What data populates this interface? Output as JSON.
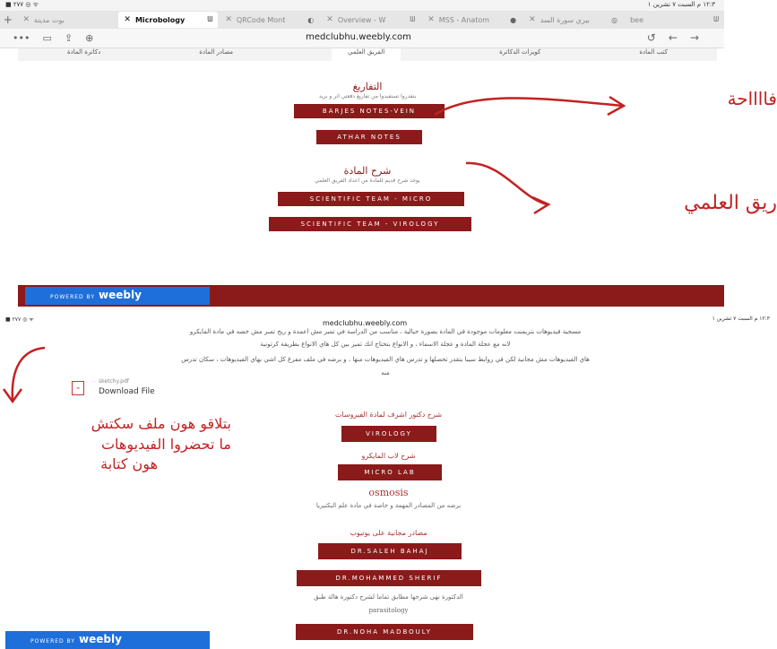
{
  "shot1": {
    "status_left": "■ ٢٧٧ ◎ ᯤ",
    "status_right": "١٢:٣ م  السبت ٧ تشرين ١",
    "tabs": [
      {
        "label": "بوت مدينة"
      },
      {
        "label": "Microbology"
      },
      {
        "label": "QRCode Mont"
      },
      {
        "label": "Overview - W"
      },
      {
        "label": "MSS - Anatom"
      },
      {
        "label": "بيري سورة السد"
      },
      {
        "label": "bee"
      }
    ],
    "url": "medclubhu.weebly.com",
    "site_nav": [
      "كتب المادة",
      "كويزات الدكاترة",
      "الفريق العلمي",
      "مصادر المادة",
      "دكاترة المادة"
    ],
    "sections": [
      {
        "title": "التفاريغ",
        "subtitle": "بتقدروا تستفيدوا من تفاريغ دفعتي اثر و بريد",
        "buttons": [
          "BARJES NOTES-VEIN",
          "ATHAR NOTES"
        ]
      },
      {
        "title": "شرح المادة",
        "subtitle": "يوجد شرح قديم للمادة من اعداد الفريق العلمي",
        "buttons": [
          "SCIENTIFIC TEAM - MICRO",
          "SCIENTIFIC TEAM - VIROLOGY"
        ]
      }
    ],
    "weebly": {
      "powered": "POWERED BY",
      "brand": "weebly"
    },
    "annotations": [
      "فااااحة",
      "ريق العلمي"
    ]
  },
  "shot2": {
    "status_left": "■ ٢٧٧ ◎ ᯤ",
    "status_center": "medclubhu.weebly.com",
    "status_right": "١٢:٣ م  السبت ٧ تشرين ١",
    "paragraph": [
      "مسحية فيديوهات بتريمنت معلومات موجودة في المادة بصورة خيالية ، مناسب من الدراسة في تمبر مش اعمدة و ريح تمبر مش خصه في مادة المايكرو",
      "لانه مع عجلة المادة و عجلة الاسماء ، و الانواع بتحتاج انك تميز بين كل هاي الانواع بطريقة كرتونية",
      "هاي الفيديوهات مش مجانية لكن في روابط سيبا بتقدر تحصلها و تدرس هاي الفيديوهات منها ، و برضه في ملف مفرغ كل اشي بهاي الفيديوهات ، سكان تدرس",
      "منه"
    ],
    "download": {
      "filename": "sketchy.pdf",
      "label": "Download File"
    },
    "annotation_lines": [
      "بتلاقو هون ملف سكتش",
      "ما تحضروا الفيديوهات",
      "هون كتابة"
    ],
    "items": [
      {
        "label": "شرح دكتور اشرف لمادة الفيروسات",
        "button": "VIROLOGY"
      },
      {
        "label": "شرح لاب المايكرو",
        "button": "MICRO LAB"
      }
    ],
    "osmosis": {
      "title": "osmosis",
      "desc": "برضه من المصادر المهمة و خاصة في مادة علم البكتيريا"
    },
    "free_label": "مصادر مجانية على يوتيوب",
    "free_buttons": [
      "DR.SALEH BAHAJ",
      "DR.MOHAMMED SHERIF"
    ],
    "note": "الدكتورة نهى شرحها مطابق تماما لشرح دكتورة هالة طبق",
    "note_word": "parasitology",
    "last_button": "DR.NOHA MADBOULY",
    "weebly": {
      "powered": "POWERED BY",
      "brand": "weebly"
    }
  },
  "colors": {
    "accent": "#8b1a1a",
    "annotation": "#c22222",
    "weebly": "#1e6fd9"
  }
}
